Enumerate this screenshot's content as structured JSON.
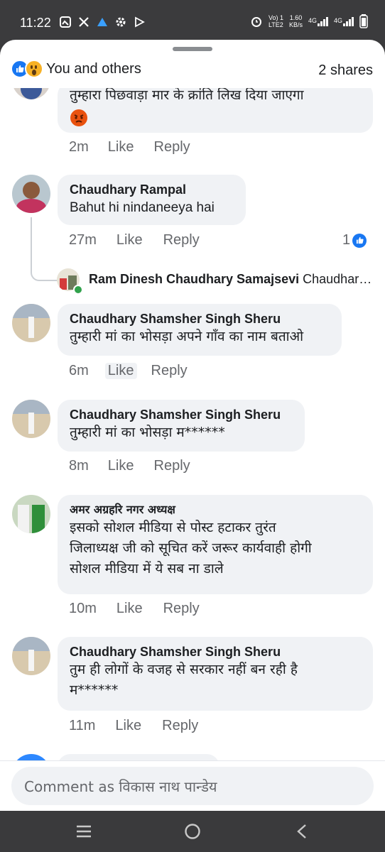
{
  "status_bar": {
    "time": "11:22",
    "net_line1": "Vo) 1",
    "net_line2": "LTE2",
    "speed_line1": "1.60",
    "speed_line2": "KB/s",
    "sim1": "4G",
    "sim2": "4G"
  },
  "header": {
    "reactions_text": "You and others",
    "shares_text": "2 shares"
  },
  "comments": [
    {
      "text": "तुम्हारा  पिछवाड़ा  मार के क्रांति लिख दिया जाएगा",
      "time": "2m",
      "like": "Like",
      "reply": "Reply"
    },
    {
      "author": "Chaudhary Rampal",
      "text": "Bahut hi nindaneeya hai",
      "time": "27m",
      "like": "Like",
      "reply": "Reply",
      "reaction_count": "1"
    },
    {
      "reply_author": "Ram Dinesh Chaudhary Samajsevi",
      "reply_preview": "Chaudhar…"
    },
    {
      "author": "Chaudhary Shamsher Singh Sheru",
      "text": "तुम्हारी मां का भोसड़ा अपने गाँव का नाम बताओ",
      "time": "6m",
      "like": "Like",
      "reply": "Reply"
    },
    {
      "author": "Chaudhary Shamsher Singh Sheru",
      "text": "तुम्हारी मां का भोसड़ा म******",
      "time": "8m",
      "like": "Like",
      "reply": "Reply"
    },
    {
      "author": "अमर अग्रहरि नगर अध्यक्ष",
      "text_lines": [
        "इसको सोशल मीडिया से पोस्ट हटाकर तुरंत",
        "जिलाध्यक्ष जी को सूचित करें जरूर कार्यवाही होगी",
        "सोशल मीडिया में ये सब ना डाले"
      ],
      "time": "10m",
      "like": "Like",
      "reply": "Reply"
    },
    {
      "author": "Chaudhary Shamsher Singh Sheru",
      "text_lines": [
        "तुम ही लोगों के वजह से सरकार नहीं बन रही है",
        "म******"
      ],
      "time": "11m",
      "like": "Like",
      "reply": "Reply"
    }
  ],
  "composer": {
    "placeholder": "Comment as विकास नाथ पान्डेय"
  },
  "icons": {
    "like": "like-reaction-icon",
    "wow": "wow-reaction-icon",
    "angry": "angry-emoji-icon",
    "nav_recent": "menu-icon",
    "nav_home": "home-circle-icon",
    "nav_back": "back-chevron-icon"
  },
  "colors": {
    "accent": "#1877f2",
    "bubble": "#f0f2f5",
    "meta_text": "#65676b",
    "online": "#31a24c",
    "angry": "#e9520f"
  }
}
